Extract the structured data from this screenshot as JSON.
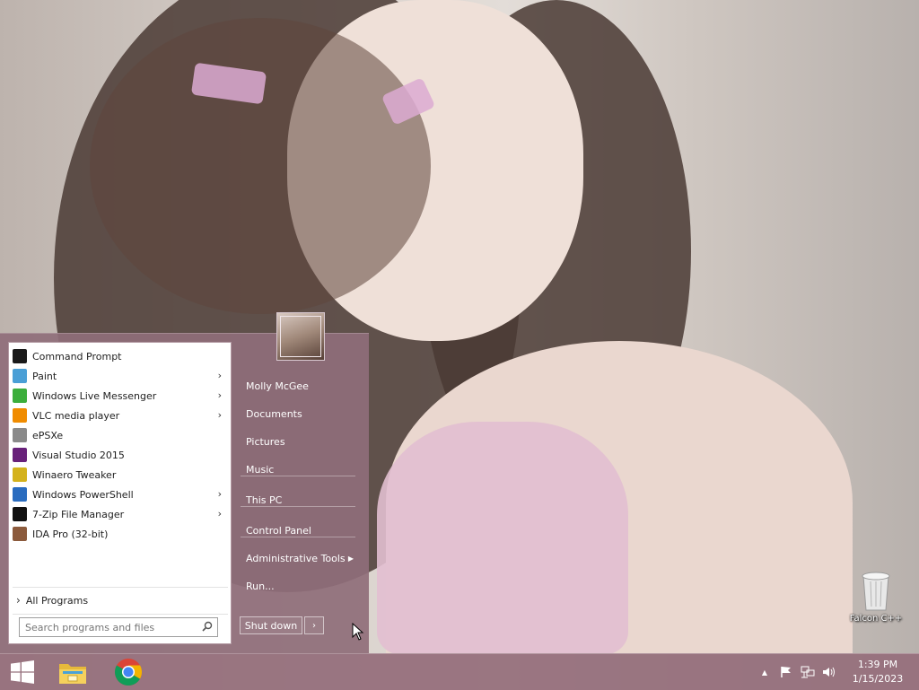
{
  "start_menu": {
    "programs": [
      {
        "label": "Command Prompt",
        "icon": "command-prompt-icon",
        "color": "#1a1a1a",
        "has_submenu": false
      },
      {
        "label": "Paint",
        "icon": "paint-icon",
        "color": "#4a9fd6",
        "has_submenu": true
      },
      {
        "label": "Windows Live Messenger",
        "icon": "messenger-icon",
        "color": "#3cae3c",
        "has_submenu": true
      },
      {
        "label": "VLC media player",
        "icon": "vlc-icon",
        "color": "#f08c00",
        "has_submenu": true
      },
      {
        "label": "ePSXe",
        "icon": "epsxe-icon",
        "color": "#8a8a8a",
        "has_submenu": false
      },
      {
        "label": "Visual Studio 2015",
        "icon": "visual-studio-icon",
        "color": "#68217a",
        "has_submenu": false
      },
      {
        "label": "Winaero Tweaker",
        "icon": "winaero-icon",
        "color": "#d4b21c",
        "has_submenu": false
      },
      {
        "label": "Windows PowerShell",
        "icon": "powershell-icon",
        "color": "#2a6cbf",
        "has_submenu": true
      },
      {
        "label": "7-Zip File Manager",
        "icon": "7zip-icon",
        "color": "#111111",
        "has_submenu": true
      },
      {
        "label": "IDA Pro (32-bit)",
        "icon": "ida-pro-icon",
        "color": "#8b5a3c",
        "has_submenu": false
      }
    ],
    "all_programs_label": "All Programs",
    "search_placeholder": "Search programs and files",
    "user_name": "Molly McGee",
    "right_items": [
      {
        "label": "Documents"
      },
      {
        "label": "Pictures"
      },
      {
        "label": "Music"
      },
      {
        "label": "This PC"
      },
      {
        "label": "Control Panel"
      },
      {
        "label": "Administrative Tools",
        "has_submenu": true
      },
      {
        "label": "Run..."
      }
    ],
    "shutdown_label": "Shut down"
  },
  "desktop": {
    "recycle_bin_label": "Falcon C++"
  },
  "taskbar": {
    "pinned": [
      "file-explorer-icon",
      "chrome-icon"
    ],
    "clock_time": "1:39 PM",
    "clock_date": "1/15/2023"
  },
  "colors": {
    "menu_bg": "#8f6e7a",
    "taskbar_bg": "#96707c",
    "accent": "#ffffff"
  }
}
